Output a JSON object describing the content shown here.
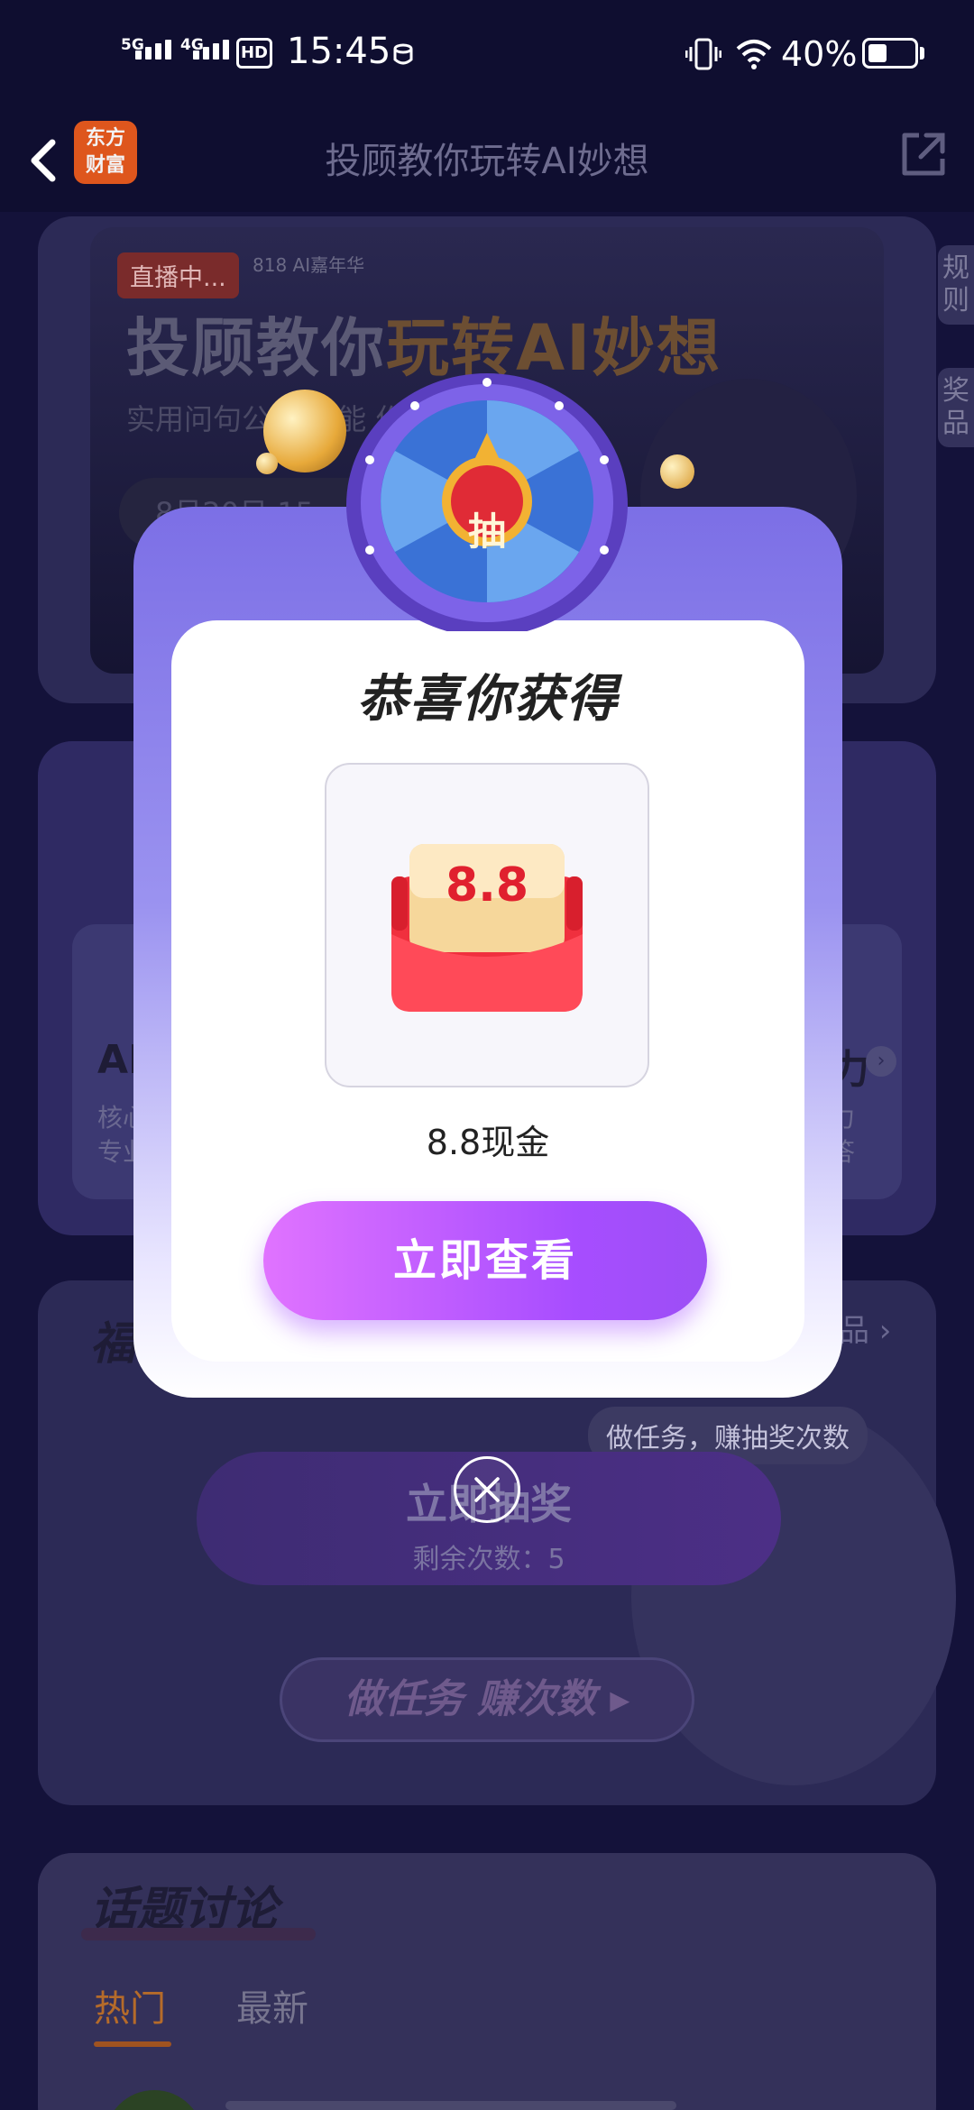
{
  "status_bar": {
    "network1": "5G",
    "network2": "4G",
    "hd": "HD",
    "time": "15:45",
    "battery": "40%"
  },
  "header": {
    "title": "投顾教你玩转AI妙想",
    "logo_line1": "东方",
    "logo_line2": "财富"
  },
  "banner": {
    "live_badge": "直播中...",
    "event_tag": "818 AI嘉年华",
    "title_part1": "投顾教你",
    "title_part2": "玩转AI妙想",
    "subline": "实用问句公开  技能  作流",
    "date_partial": "8月20日 15"
  },
  "side_tabs": {
    "rules": "规则",
    "prizes": "奖品"
  },
  "ai_section": {
    "left_heading": "AI",
    "left_desc1": "核心",
    "left_desc2": "专业",
    "right_heading": "力",
    "right_desc1": "力",
    "right_desc2": "答"
  },
  "lottery": {
    "heading": "福",
    "prize_link": "品",
    "tip": "做任务，赚抽奖次数",
    "draw_label": "立即抽奖",
    "remaining": "剩余次数：5",
    "task_button": "做任务 赚次数"
  },
  "topics": {
    "heading": "话题讨论",
    "tab_hot": "热门",
    "tab_new": "最新"
  },
  "modal": {
    "wheel_label": "抽",
    "title": "恭喜你获得",
    "envelope_amount": "8.8",
    "prize_name": "8.8现金",
    "view_button": "立即查看"
  },
  "colors": {
    "modal_top": "#7c6fe6",
    "button_start": "#e073ff",
    "button_end": "#a74dff",
    "envelope_red": "#f0303e"
  }
}
